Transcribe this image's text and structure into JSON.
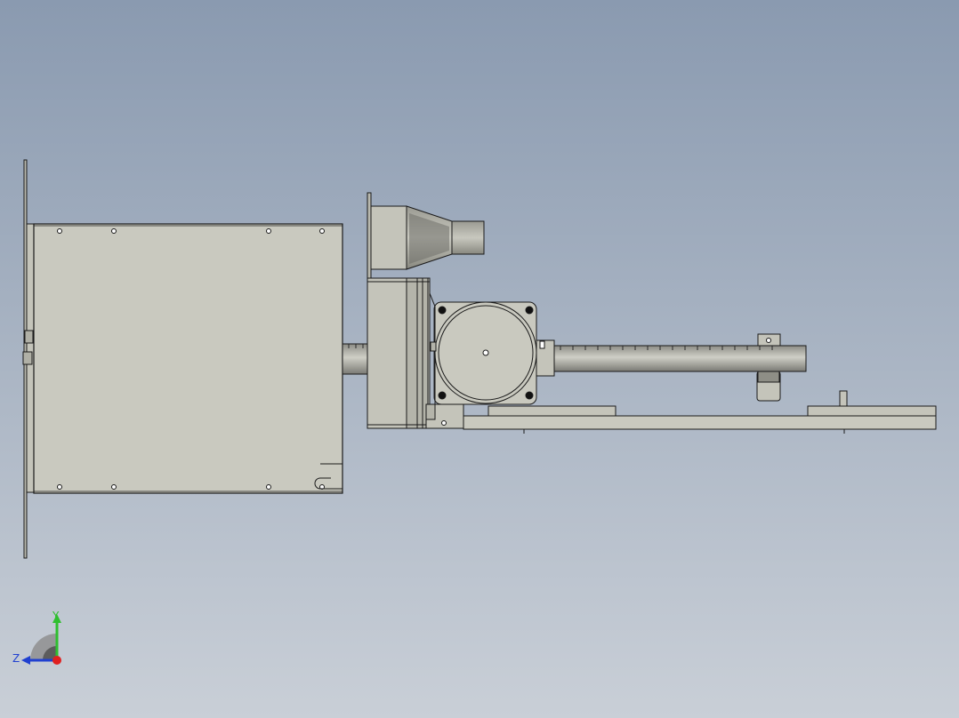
{
  "viewport": {
    "background_top": "#8a9ab0",
    "background_bottom": "#c9cfd7"
  },
  "model": {
    "part_fill": "#c9c9bf",
    "part_fill_dark": "#a9a99f",
    "part_fill_shadow": "#6e6e6a",
    "edge_color": "#1a1a1a"
  },
  "triad": {
    "y_label": "Y",
    "z_label": "Z",
    "y_color": "#2fbf2f",
    "z_color": "#2040d0",
    "origin_color": "#e02020"
  }
}
